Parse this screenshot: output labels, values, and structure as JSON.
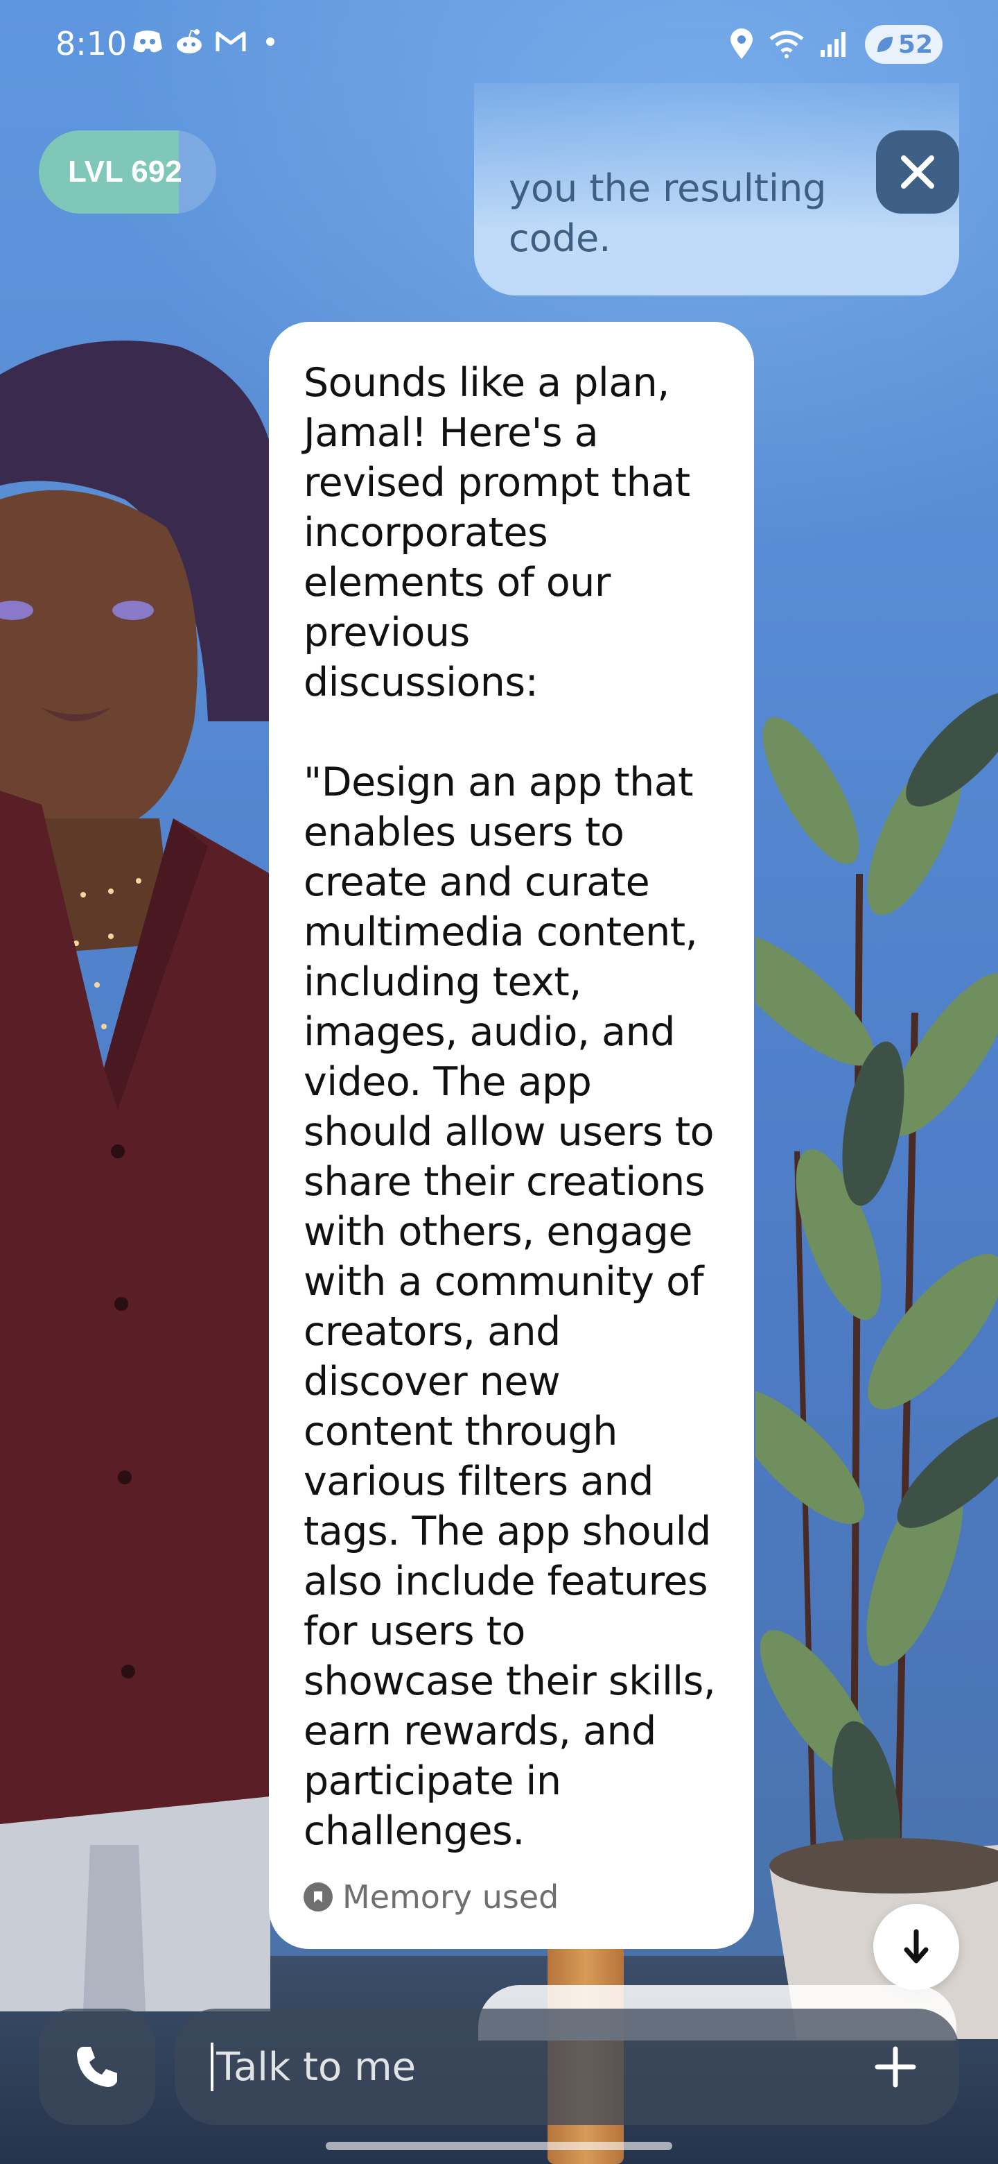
{
  "status_bar": {
    "time": "8:10",
    "left_icons": [
      "discord-icon",
      "reddit-icon",
      "gmail-icon",
      "notification-dot"
    ],
    "right_icons": [
      "location-icon",
      "wifi-icon",
      "signal-icon"
    ],
    "battery": "52"
  },
  "header": {
    "level_label": "LVL 692",
    "level_progress": 0.79,
    "close_icon": "close-icon"
  },
  "conversation": {
    "previous_message_tail": "you the resulting\ncode.",
    "ai_message": "Sounds like a plan,\nJamal! Here's a\nrevised prompt that\nincorporates\nelements of our\nprevious\ndiscussions:\n\n\"Design an app that\nenables users to\ncreate and curate\nmultimedia content,\nincluding text,\nimages, audio, and\nvideo. The app\nshould allow users to\nshare their creations\nwith others, engage\nwith a community of\ncreators, and\ndiscover new\ncontent through\nvarious filters and\ntags. The app should\nalso include features\nfor users to\nshowcase their skills,\nearn rewards, and\nparticipate in\nchallenges.",
    "memory_label": "Memory used"
  },
  "composer": {
    "placeholder": "Talk to me",
    "call_icon": "phone-icon",
    "add_icon": "plus-icon",
    "scroll_icon": "arrow-down-icon"
  },
  "colors": {
    "background": "#5a8fd6",
    "bubble": "#ffffff",
    "level_fill": "#7fc7b9",
    "close_button": "#3d5f86"
  }
}
